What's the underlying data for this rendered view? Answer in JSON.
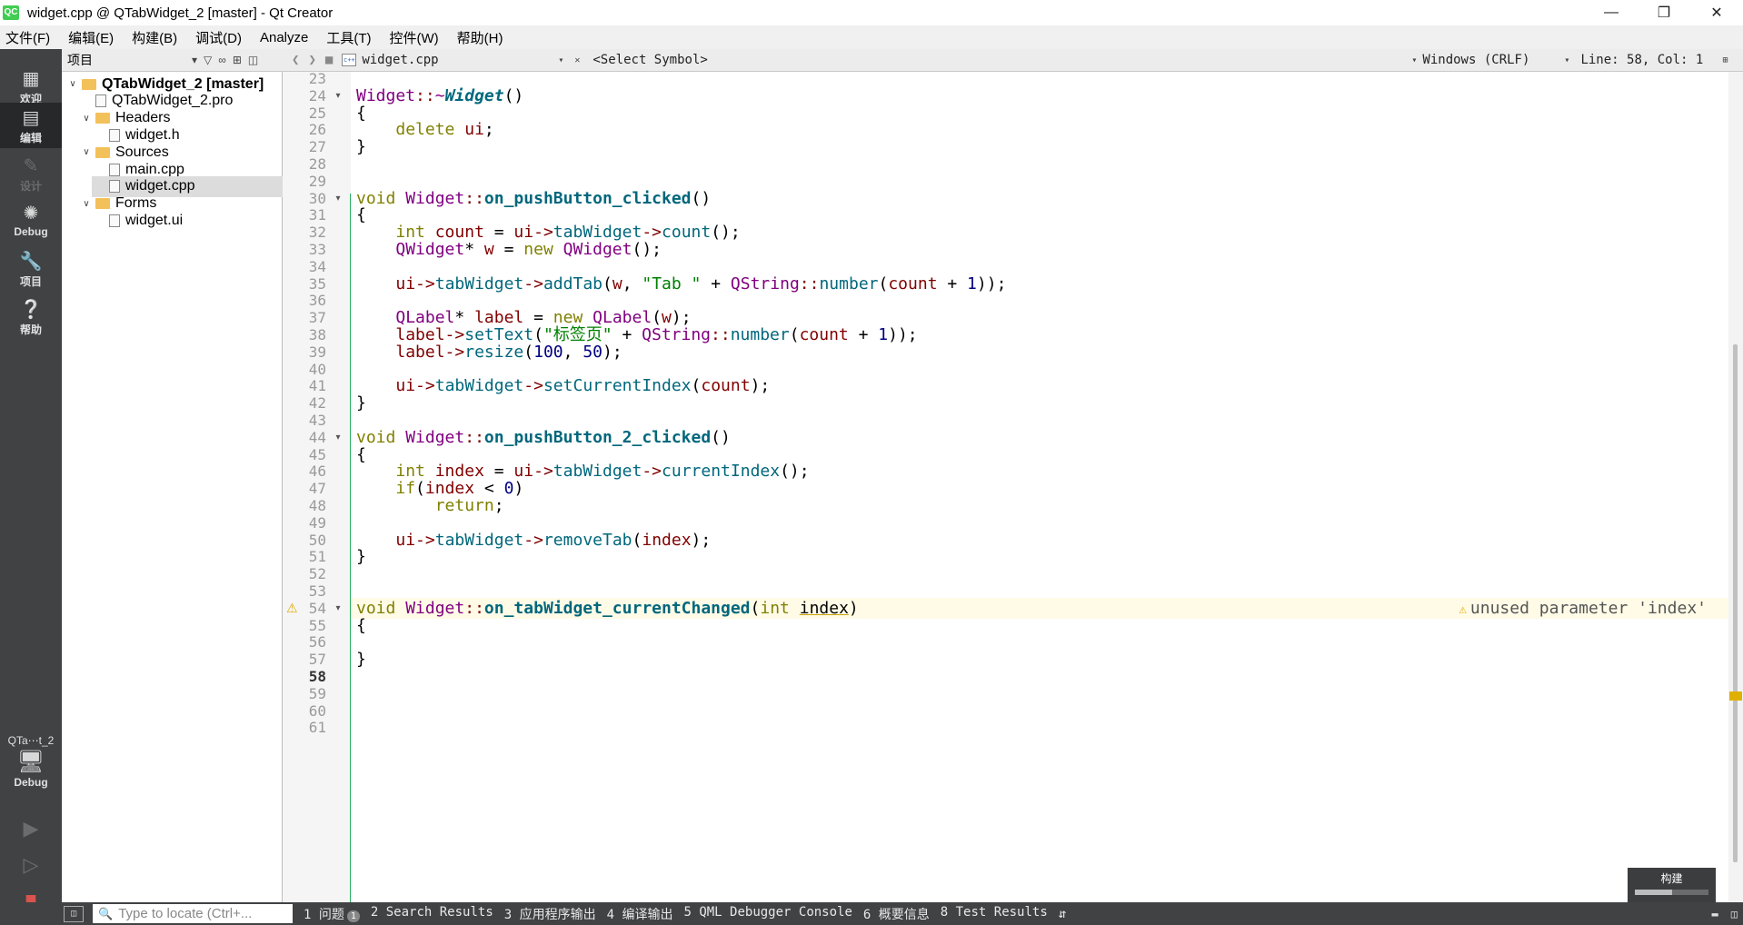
{
  "window": {
    "title": "widget.cpp @ QTabWidget_2 [master] - Qt Creator",
    "app_icon": "QC"
  },
  "menu": [
    "文件(F)",
    "编辑(E)",
    "构建(B)",
    "调试(D)",
    "Analyze",
    "工具(T)",
    "控件(W)",
    "帮助(H)"
  ],
  "modes": [
    {
      "label": "欢迎",
      "icon": "grid-icon"
    },
    {
      "label": "编辑",
      "icon": "edit-icon"
    },
    {
      "label": "设计",
      "icon": "pencil-icon"
    },
    {
      "label": "Debug",
      "icon": "bug-icon"
    },
    {
      "label": "项目",
      "icon": "wrench-icon"
    },
    {
      "label": "帮助",
      "icon": "help-icon"
    }
  ],
  "kit": {
    "name": "QTa⋯t_2",
    "mode": "Debug"
  },
  "project_pane": {
    "title": "项目",
    "tree": [
      {
        "label": "QTabWidget_2 [master]",
        "level": 0,
        "expanded": true,
        "type": "project"
      },
      {
        "label": "QTabWidget_2.pro",
        "level": 1,
        "type": "pro"
      },
      {
        "label": "Headers",
        "level": 1,
        "expanded": true,
        "type": "folder"
      },
      {
        "label": "widget.h",
        "level": 2,
        "type": "h"
      },
      {
        "label": "Sources",
        "level": 1,
        "expanded": true,
        "type": "folder"
      },
      {
        "label": "main.cpp",
        "level": 2,
        "type": "cpp"
      },
      {
        "label": "widget.cpp",
        "level": 2,
        "type": "cpp",
        "selected": true
      },
      {
        "label": "Forms",
        "level": 1,
        "expanded": true,
        "type": "folder"
      },
      {
        "label": "widget.ui",
        "level": 2,
        "type": "ui"
      }
    ]
  },
  "editor": {
    "file_name": "widget.cpp",
    "symbol": "<Select Symbol>",
    "encoding": "Windows (CRLF)",
    "position": "Line: 58, Col: 1",
    "current_line": 58,
    "warning": {
      "line": 54,
      "message": "unused parameter 'index'"
    },
    "lines": [
      {
        "n": 23,
        "text": ""
      },
      {
        "n": 24,
        "text": "Widget::~Widget()"
      },
      {
        "n": 25,
        "text": "{"
      },
      {
        "n": 26,
        "text": "    delete ui;"
      },
      {
        "n": 27,
        "text": "}"
      },
      {
        "n": 28,
        "text": ""
      },
      {
        "n": 29,
        "text": ""
      },
      {
        "n": 30,
        "text": "void Widget::on_pushButton_clicked()"
      },
      {
        "n": 31,
        "text": "{"
      },
      {
        "n": 32,
        "text": "    int count = ui->tabWidget->count();"
      },
      {
        "n": 33,
        "text": "    QWidget* w = new QWidget();"
      },
      {
        "n": 34,
        "text": ""
      },
      {
        "n": 35,
        "text": "    ui->tabWidget->addTab(w, \"Tab \" + QString::number(count + 1));"
      },
      {
        "n": 36,
        "text": ""
      },
      {
        "n": 37,
        "text": "    QLabel* label = new QLabel(w);"
      },
      {
        "n": 38,
        "text": "    label->setText(\"标签页\" + QString::number(count + 1));"
      },
      {
        "n": 39,
        "text": "    label->resize(100, 50);"
      },
      {
        "n": 40,
        "text": ""
      },
      {
        "n": 41,
        "text": "    ui->tabWidget->setCurrentIndex(count);"
      },
      {
        "n": 42,
        "text": "}"
      },
      {
        "n": 43,
        "text": ""
      },
      {
        "n": 44,
        "text": "void Widget::on_pushButton_2_clicked()"
      },
      {
        "n": 45,
        "text": "{"
      },
      {
        "n": 46,
        "text": "    int index = ui->tabWidget->currentIndex();"
      },
      {
        "n": 47,
        "text": "    if(index < 0)"
      },
      {
        "n": 48,
        "text": "        return;"
      },
      {
        "n": 49,
        "text": ""
      },
      {
        "n": 50,
        "text": "    ui->tabWidget->removeTab(index);"
      },
      {
        "n": 51,
        "text": "}"
      },
      {
        "n": 52,
        "text": ""
      },
      {
        "n": 53,
        "text": ""
      },
      {
        "n": 54,
        "text": "void Widget::on_tabWidget_currentChanged(int index)"
      },
      {
        "n": 55,
        "text": "{"
      },
      {
        "n": 56,
        "text": ""
      },
      {
        "n": 57,
        "text": "}"
      },
      {
        "n": 58,
        "text": ""
      },
      {
        "n": 59,
        "text": ""
      },
      {
        "n": 60,
        "text": ""
      },
      {
        "n": 61,
        "text": ""
      }
    ]
  },
  "build": {
    "label": "构建",
    "progress": 0.5
  },
  "statusbar": {
    "locator_placeholder": "Type to locate (Ctrl+...",
    "tabs": [
      {
        "label": "1 问题",
        "badge": "1"
      },
      {
        "label": "2 Search Results"
      },
      {
        "label": "3 应用程序输出"
      },
      {
        "label": "4 编译输出"
      },
      {
        "label": "5 QML Debugger Console"
      },
      {
        "label": "6 概要信息"
      },
      {
        "label": "8 Test Results"
      }
    ]
  }
}
